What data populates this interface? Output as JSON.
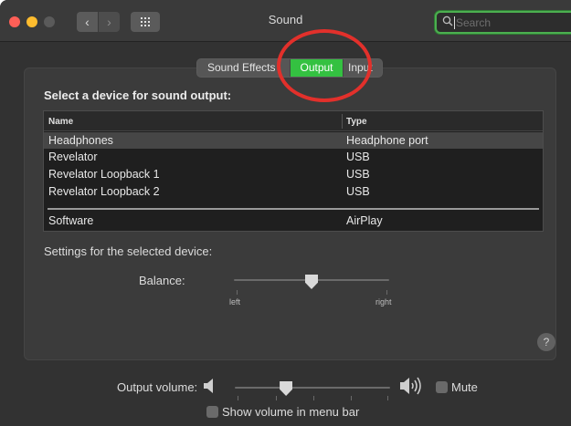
{
  "window": {
    "title": "Sound",
    "search_placeholder": "Search",
    "search_icon": "magnifier-icon",
    "nav_back_glyph": "‹",
    "nav_forward_glyph": "›"
  },
  "tabs": [
    {
      "label": "Sound Effects",
      "selected": false
    },
    {
      "label": "Output",
      "selected": true
    },
    {
      "label": "Input",
      "selected": false
    }
  ],
  "output": {
    "section_title": "Select a device for sound output:",
    "columns": [
      "Name",
      "Type"
    ],
    "devices": [
      {
        "name": "Headphones",
        "type": "Headphone port",
        "selected": true
      },
      {
        "name": "Revelator",
        "type": "USB",
        "selected": false
      },
      {
        "name": "Revelator Loopback 1",
        "type": "USB",
        "selected": false
      },
      {
        "name": "Revelator Loopback 2",
        "type": "USB",
        "selected": false
      },
      {
        "name": "Software",
        "type": "AirPlay",
        "selected": false
      }
    ],
    "settings_label": "Settings for the selected device:",
    "balance_label": "Balance:",
    "balance_left": "left",
    "balance_right": "right",
    "balance_value": 0.5,
    "help_glyph": "?"
  },
  "volume": {
    "label": "Output volume:",
    "level": 0.33,
    "mute_label": "Mute",
    "mute_checked": false,
    "show_in_menu_bar_label": "Show volume in menu bar",
    "show_in_menu_bar_checked": false
  },
  "colors": {
    "accent_green": "#34c141",
    "annotation_red": "#e2302b",
    "search_focus": "#4caf50"
  }
}
